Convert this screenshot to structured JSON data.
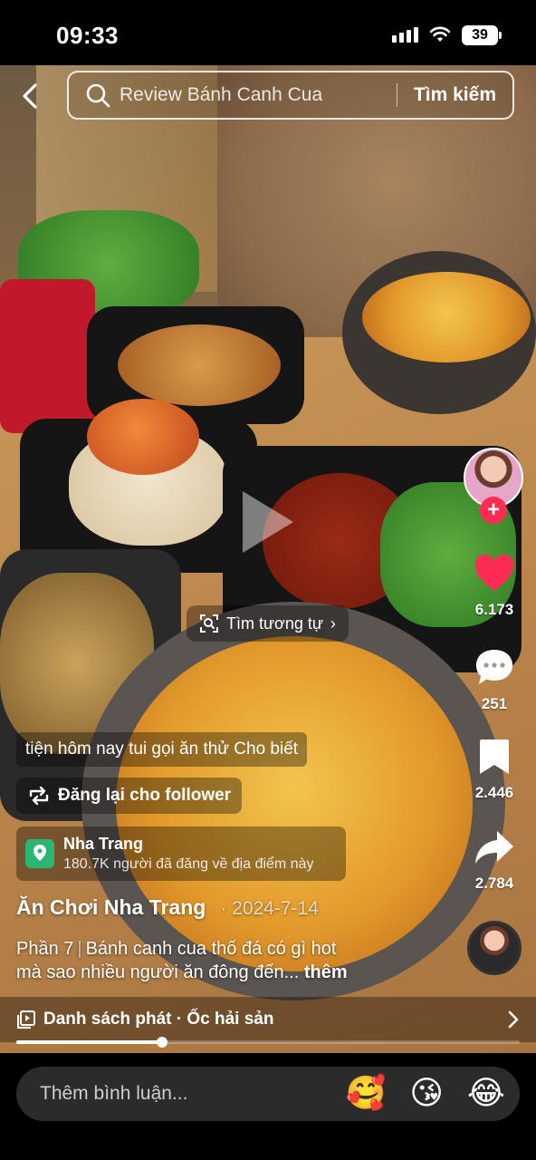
{
  "status_bar": {
    "time": "09:33",
    "battery": "39"
  },
  "search": {
    "query": "Review Bánh Canh Cua",
    "button": "Tìm kiếm"
  },
  "overlay": {
    "similar_label": "Tìm tương tự",
    "similar_chevron": "›"
  },
  "actions": {
    "likes": "6.173",
    "comments": "251",
    "saves": "2.446",
    "shares": "2.784",
    "follow_symbol": "+"
  },
  "caption": {
    "scroll_line": "tiện hôm nay tui gọi ăn thử Cho biết",
    "repost": "Đăng lại cho follower"
  },
  "location": {
    "name": "Nha Trang",
    "subtitle": "180.7K người đã đăng về địa điểm này"
  },
  "post": {
    "author": "Ăn Chơi Nha Trang",
    "date": "· 2024-7-14",
    "part": "Phần 7",
    "separator": "|",
    "description_1": "Bánh canh cua thố đá có gì hot",
    "description_2": "mà sao nhiều người ăn đông đến...",
    "more": "thêm"
  },
  "playlist": {
    "label": "Danh sách phát · Ốc hải sản",
    "progress": 0.29
  },
  "comment_bar": {
    "placeholder": "Thêm bình luận...",
    "emojis": [
      "🥰",
      "😘",
      "😂"
    ]
  },
  "icons": [
    "back-icon",
    "search-icon",
    "play-icon",
    "heart-icon",
    "comment-icon",
    "bookmark-icon",
    "share-icon",
    "repost-icon",
    "location-pin-icon",
    "playlist-icon",
    "chevron-right-icon",
    "image-search-icon"
  ],
  "colors": {
    "like": "#fe2c55",
    "follow": "#fe2c55",
    "location": "#2bb673"
  }
}
